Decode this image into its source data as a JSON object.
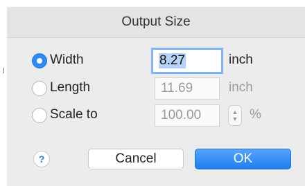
{
  "dialog": {
    "title": "Output Size"
  },
  "options": {
    "width": {
      "label": "Width",
      "value": "8.27",
      "unit": "inch",
      "selected": true
    },
    "length": {
      "label": "Length",
      "value": "11.69",
      "unit": "inch",
      "selected": false
    },
    "scale": {
      "label": "Scale to",
      "value": "100.00",
      "unit": "%",
      "selected": false
    }
  },
  "buttons": {
    "help": "?",
    "cancel": "Cancel",
    "ok": "OK"
  },
  "icons": {
    "stepper_up": "▲",
    "stepper_down": "▼"
  },
  "colors": {
    "accent": "#2d8bf2",
    "focus_ring": "#7fb5f5"
  }
}
